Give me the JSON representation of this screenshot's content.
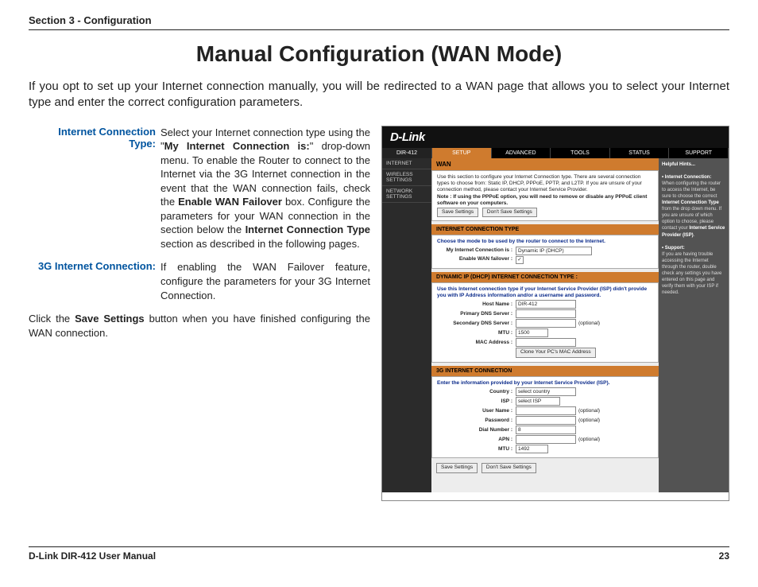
{
  "header": "Section 3 - Configuration",
  "title": "Manual Configuration (WAN Mode)",
  "intro": "If you opt to set up your Internet connection manually, you will be redirected to a WAN page that allows you to select your Internet type and enter the correct configuration parameters.",
  "defs": {
    "ict_label": "Internet Connection Type:",
    "ict_pre": "Select your Internet connection type using the \"",
    "ict_b1": "My Internet Connection is:",
    "ict_mid1": "\" drop-down menu. To enable the Router to connect to the Internet via the 3G Internet connection in the event that the WAN connection fails, check the ",
    "ict_b2": "Enable WAN Failover",
    "ict_mid2": " box. Configure the parameters for your WAN connection in the section below the ",
    "ict_b3": "Internet Connection Type",
    "ict_post": " section as described in the following pages.",
    "g3_label": "3G Internet Connection:",
    "g3_text": "If enabling the WAN Failover feature, configure the parameters for your 3G Internet Connection."
  },
  "closing_pre": "Click the ",
  "closing_b": "Save Settings",
  "closing_post": " button when you have finished configuring the WAN connection.",
  "shot": {
    "brand": "D-Link",
    "product": "DIR-412",
    "tabs": {
      "setup": "SETUP",
      "adv": "ADVANCED",
      "tools": "TOOLS",
      "status": "STATUS",
      "support": "SUPPORT"
    },
    "side": {
      "internet": "INTERNET",
      "wireless": "WIRELESS SETTINGS",
      "network": "NETWORK SETTINGS"
    },
    "wan": {
      "title": "WAN",
      "desc": "Use this section to configure your Internet Connection type. There are several connection types to choose from: Static IP, DHCP, PPPoE, PPTP, and L2TP. If you are unsure of your connection method, please contact your Internet Service Provider.",
      "note": "Note : If using the PPPoE option, you will need to remove or disable any PPPoE client software on your computers.",
      "save": "Save Settings",
      "dont": "Don't Save Settings"
    },
    "ict": {
      "title": "INTERNET CONNECTION TYPE",
      "choose": "Choose the mode to be used by the router to connect to the Internet.",
      "mylab": "My Internet Connection is :",
      "myval": "Dynamic IP (DHCP)",
      "fail_lab": "Enable WAN failover :"
    },
    "dhcp": {
      "title": "DYNAMIC IP (DHCP) INTERNET CONNECTION TYPE :",
      "desc": "Use this Internet connection type if your Internet Service Provider (ISP) didn't provide you with IP Address information and/or a username and password.",
      "host_l": "Host Name :",
      "host_v": "DIR-412",
      "pdns_l": "Primary DNS Server :",
      "sdns_l": "Secondary DNS Server :",
      "opt": "(optional)",
      "mtu_l": "MTU :",
      "mtu_v": "1500",
      "mac_l": "MAC Address :",
      "clone": "Clone Your PC's MAC Address"
    },
    "g3": {
      "title": "3G INTERNET CONNECTION",
      "desc": "Enter the information provided by your Internet Service Provider (ISP).",
      "country_l": "Country :",
      "country_v": "select country",
      "isp_l": "ISP :",
      "isp_v": "select ISP",
      "user_l": "User Name :",
      "pass_l": "Password :",
      "dial_l": "Dial Number :",
      "dial_v": "8",
      "apn_l": "APN :",
      "mtu_l": "MTU :",
      "mtu_v": "1492"
    },
    "hints": {
      "title": "Helpful Hints...",
      "h1b": "• Internet Connection:",
      "h1": "When configuring the router to access the Internet, be sure to choose the correct ",
      "h1b2": "Internet Connection Type",
      "h1c": " from the drop down menu. If you are unsure of which option to choose, please contact your ",
      "h1b3": "Internet Service Provider (ISP)",
      "h2b": "• Support:",
      "h2": "If you are having trouble accessing the Internet through the router, double check any settings you have entered on this page and verify them with your ISP if needed."
    }
  },
  "footer": {
    "left": "D-Link DIR-412 User Manual",
    "right": "23"
  }
}
